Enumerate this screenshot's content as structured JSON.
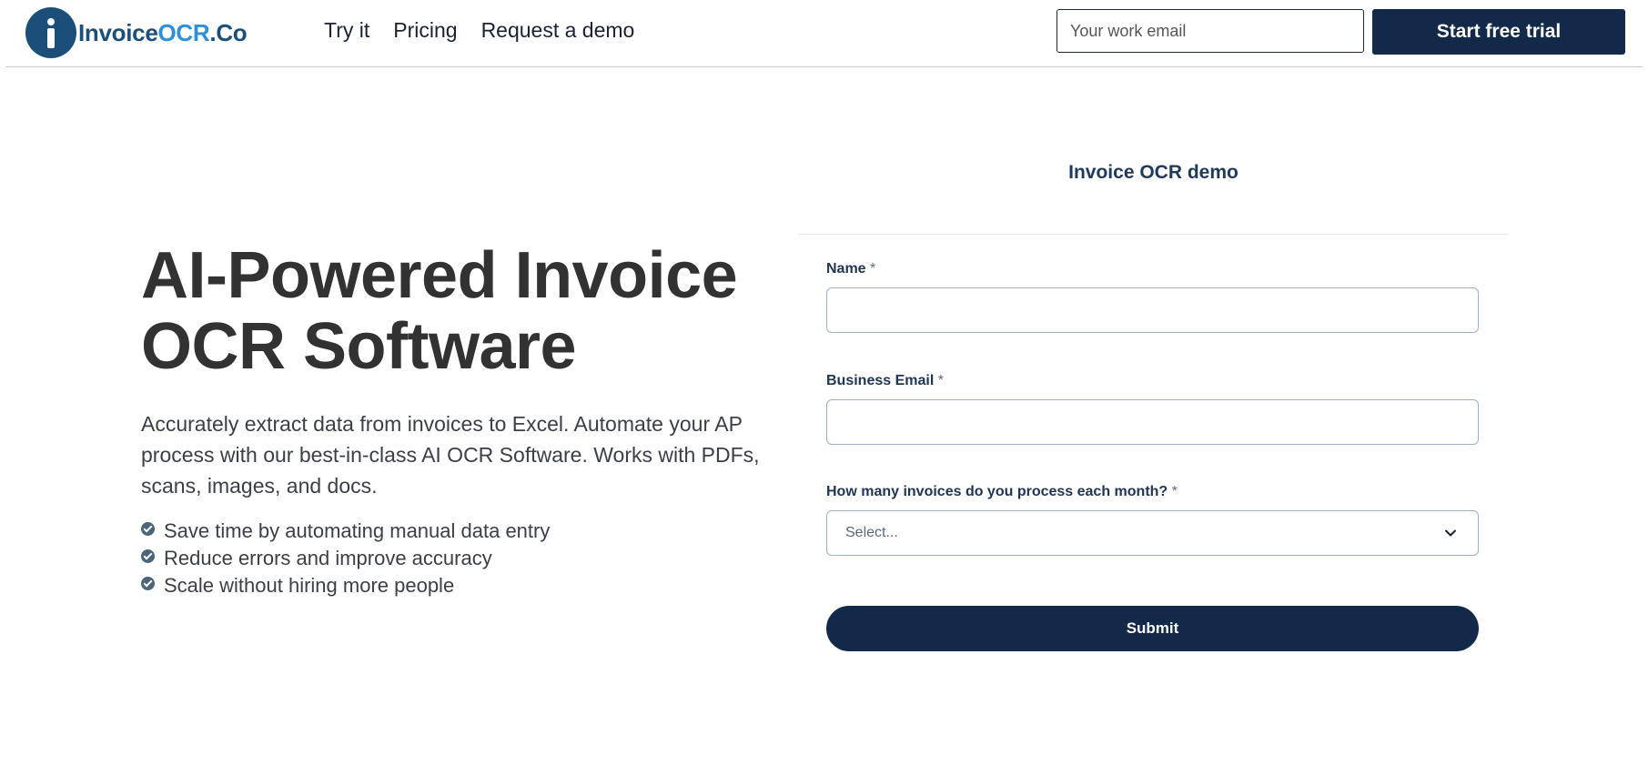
{
  "brand": {
    "part1": "Invoice",
    "part2": "OCR",
    "part3": ".Co"
  },
  "nav": [
    {
      "label": "Try it"
    },
    {
      "label": "Pricing"
    },
    {
      "label": "Request a demo"
    }
  ],
  "header": {
    "email_placeholder": "Your work email",
    "cta_label": "Start free trial"
  },
  "hero": {
    "title_line1": "AI-Powered Invoice",
    "title_line2": "OCR Software",
    "description": "Accurately extract data from invoices to Excel. Automate your AP process with our best-in-class AI OCR Software. Works with PDFs, scans, images, and docs.",
    "features": [
      "Save time by automating manual data entry",
      "Reduce errors and improve accuracy",
      "Scale without hiring more people"
    ]
  },
  "form": {
    "title": "Invoice OCR demo",
    "required_marker": "*",
    "name_label": "Name",
    "email_label": "Business Email",
    "invoices_label": "How many invoices do you process each month?",
    "invoices_value": "Select...",
    "submit_label": "Submit"
  },
  "colors": {
    "brand_dark": "#1b4f7a",
    "brand_light": "#2f8fd8",
    "cta_bg": "#12294a"
  },
  "icons": {
    "logo": "info-i-icon",
    "feature": "check-circle-icon",
    "select": "chevron-down-icon"
  }
}
